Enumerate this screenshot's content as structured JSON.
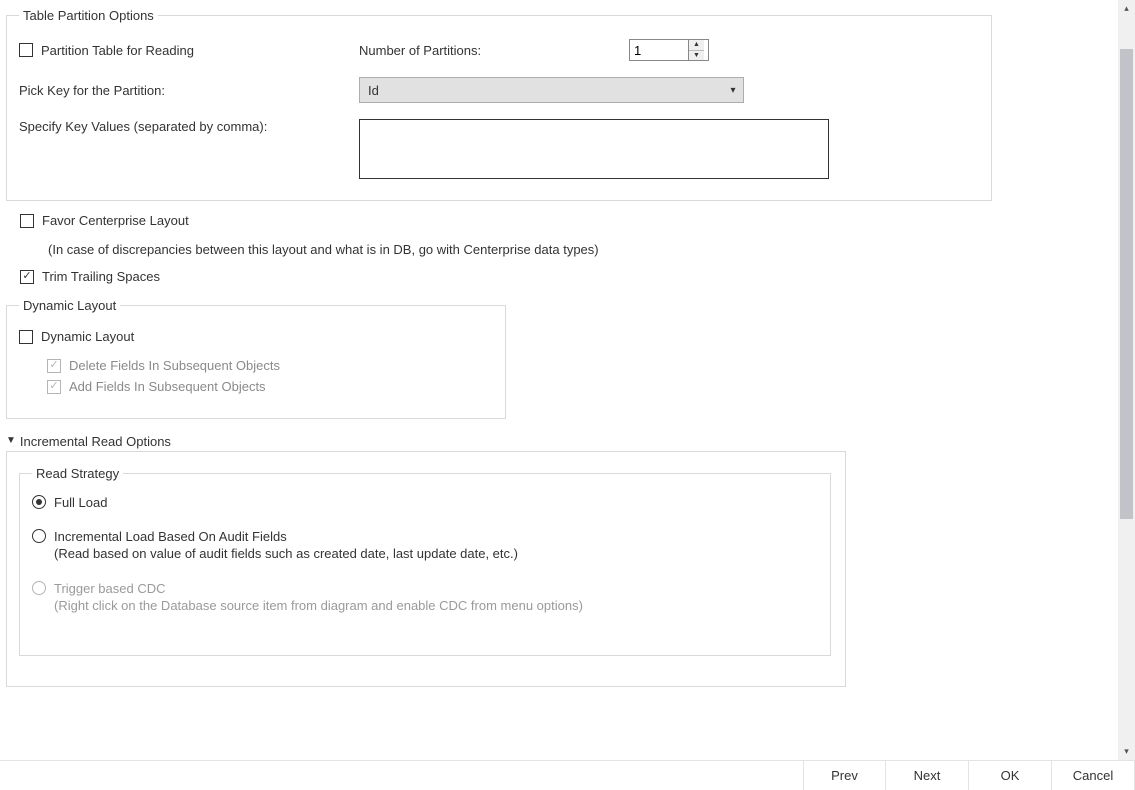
{
  "partition": {
    "legend": "Table Partition Options",
    "partition_for_reading": {
      "label": "Partition Table for Reading",
      "checked": false
    },
    "num_partitions_label": "Number of Partitions:",
    "num_partitions_value": "1",
    "pick_key_label": "Pick Key for the Partition:",
    "pick_key_selected": "Id",
    "key_values_label": "Specify Key Values (separated by comma):",
    "key_values_text": ""
  },
  "layout_options": {
    "favor_centerprise": {
      "label": "Favor Centerprise Layout",
      "checked": false
    },
    "favor_note": "(In case of discrepancies between this layout and what is in DB, go with Centerprise data types)",
    "trim_trailing": {
      "label": "Trim Trailing Spaces",
      "checked": true
    }
  },
  "dynamic": {
    "legend": "Dynamic Layout",
    "dynamic_layout": {
      "label": "Dynamic Layout",
      "checked": false
    },
    "delete_fields": {
      "label": "Delete Fields In Subsequent Objects",
      "checked": true
    },
    "add_fields": {
      "label": "Add Fields In Subsequent Objects",
      "checked": true
    }
  },
  "incremental": {
    "toggle_label": "Incremental Read Options",
    "read_strategy_legend": "Read Strategy",
    "options": [
      {
        "title": "Full Load",
        "sub": "",
        "selected": true,
        "disabled": false
      },
      {
        "title": "Incremental Load Based On Audit Fields",
        "sub": "(Read based on value of audit fields such as created date, last update date, etc.)",
        "selected": false,
        "disabled": false
      },
      {
        "title": "Trigger based CDC",
        "sub": "(Right click on the Database source item from diagram and enable CDC from menu options)",
        "selected": false,
        "disabled": true
      }
    ]
  },
  "buttons": {
    "prev": "Prev",
    "next": "Next",
    "ok": "OK",
    "cancel": "Cancel"
  }
}
